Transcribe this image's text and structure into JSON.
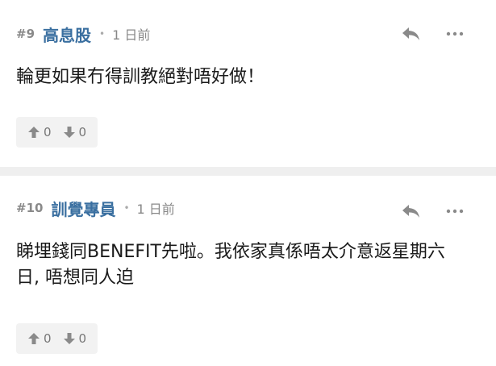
{
  "comments": [
    {
      "number": "#9",
      "username": "高息股",
      "separator": "•",
      "time": "1 日前",
      "body": "輪更如果冇得訓教絕對唔好做！",
      "upvotes": "0",
      "downvotes": "0"
    },
    {
      "number": "#10",
      "username": "訓覺專員",
      "separator": "•",
      "time": "1 日前",
      "body": "睇埋錢同BENEFIT先啦。我依家真係唔太介意返星期六日, 唔想同人迫",
      "upvotes": "0",
      "downvotes": "0"
    }
  ],
  "icons": {
    "reply": "reply-arrow-icon",
    "more": "more-dots-icon",
    "upvote": "thumb-up-arrow-icon",
    "downvote": "thumb-down-arrow-icon"
  },
  "colors": {
    "username": "#3a6fa0",
    "meta": "#888888",
    "divider": "#efefef",
    "vote_bg": "#f2f2f2"
  }
}
